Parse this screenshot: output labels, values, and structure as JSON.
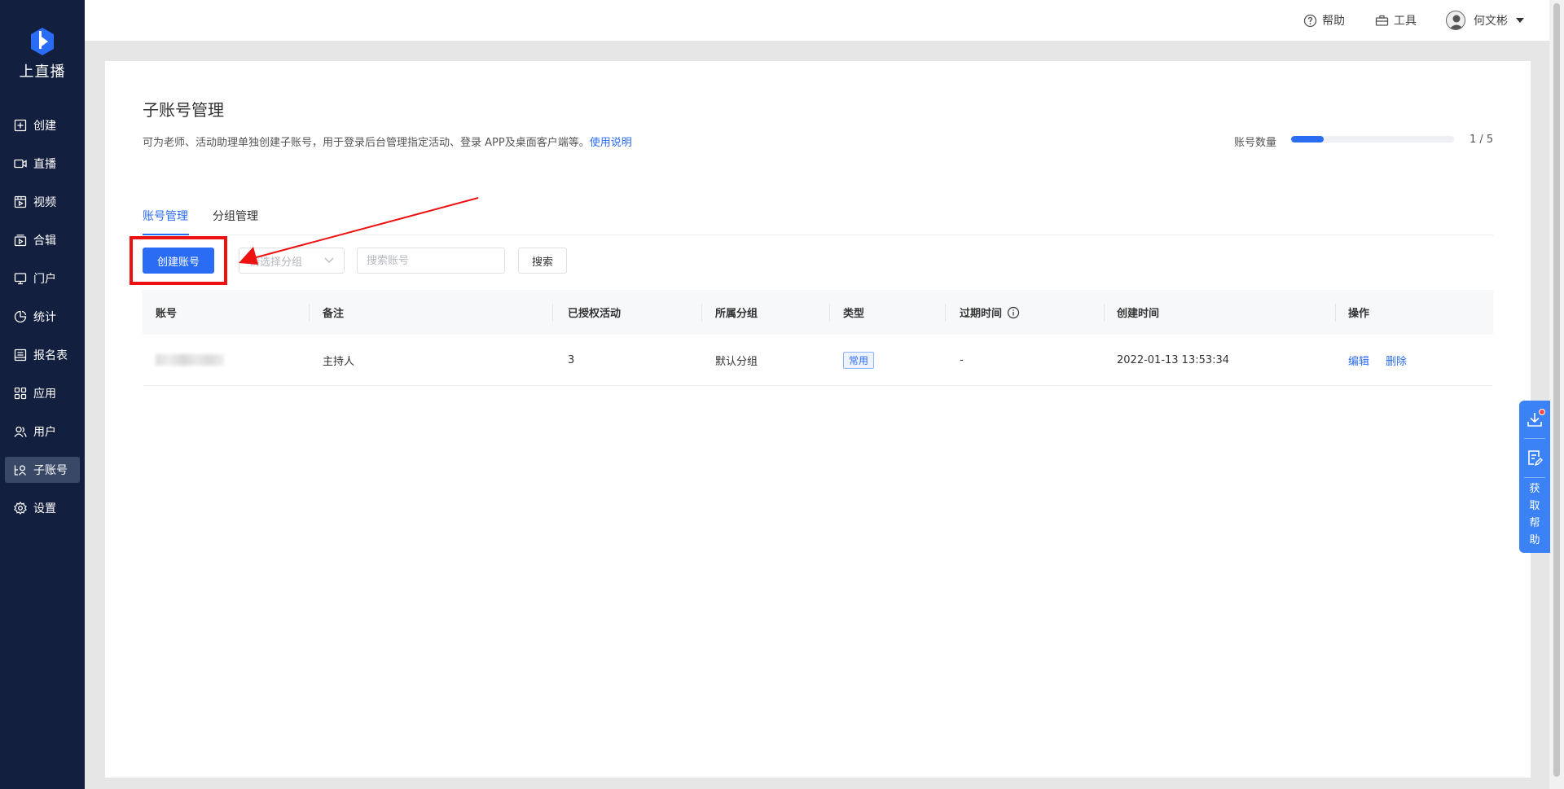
{
  "app": {
    "name": "上直播"
  },
  "sidebar": {
    "items": [
      {
        "label": "创建",
        "icon": "plus-square-icon"
      },
      {
        "label": "直播",
        "icon": "video-camera-icon"
      },
      {
        "label": "视频",
        "icon": "film-icon"
      },
      {
        "label": "合辑",
        "icon": "collection-icon"
      },
      {
        "label": "门户",
        "icon": "monitor-icon"
      },
      {
        "label": "统计",
        "icon": "pie-chart-icon"
      },
      {
        "label": "报名表",
        "icon": "form-icon"
      },
      {
        "label": "应用",
        "icon": "apps-grid-icon"
      },
      {
        "label": "用户",
        "icon": "users-icon"
      },
      {
        "label": "子账号",
        "icon": "sub-account-icon",
        "active": true
      },
      {
        "label": "设置",
        "icon": "gear-icon"
      }
    ]
  },
  "header": {
    "help": "帮助",
    "tools": "工具",
    "user": "何文彬"
  },
  "page": {
    "title": "子账号管理",
    "description": "可为老师、活动助理单独创建子账号，用于登录后台管理指定活动、登录 APP及桌面客户端等。",
    "description_link": "使用说明",
    "quota_label": "账号数量",
    "quota_used": 1,
    "quota_total": 5,
    "quota_text": "1 / 5"
  },
  "tabs": [
    {
      "label": "账号管理",
      "active": true
    },
    {
      "label": "分组管理",
      "active": false
    }
  ],
  "toolbar": {
    "create_label": "创建账号",
    "group_placeholder": "请选择分组",
    "search_placeholder": "搜索账号",
    "search_label": "搜索"
  },
  "table": {
    "columns": [
      "账号",
      "备注",
      "已授权活动",
      "所属分组",
      "类型",
      "过期时间",
      "创建时间",
      "操作"
    ],
    "rows": [
      {
        "account": "",
        "remark": "主持人",
        "authorized": "3",
        "group": "默认分组",
        "type": "常用",
        "expire": "-",
        "created": "2022-01-13 13:53:34",
        "actions": [
          "编辑",
          "删除"
        ]
      }
    ]
  },
  "float_help": {
    "text_chars": [
      "获",
      "取",
      "帮",
      "助"
    ]
  },
  "colors": {
    "accent": "#2b6cf5",
    "sidebar": "#131f3f",
    "highlight": "#ee1111"
  }
}
